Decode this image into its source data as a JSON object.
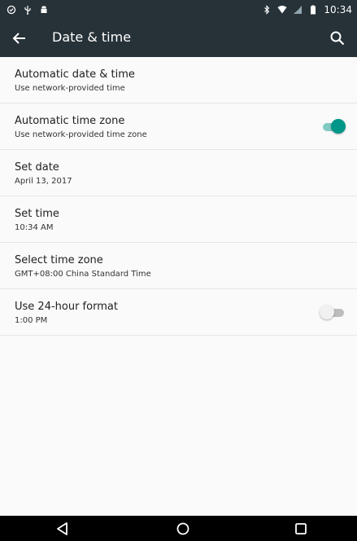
{
  "status_bar": {
    "time": "10:34",
    "icons_left": [
      "notification-icon",
      "usb-icon",
      "android-icon"
    ],
    "icons_right": [
      "bluetooth-icon",
      "wifi-icon",
      "signal-icon",
      "battery-icon"
    ]
  },
  "toolbar": {
    "title": "Date & time",
    "back_icon": "arrow-left-icon",
    "search_icon": "search-icon",
    "background": "#263238"
  },
  "settings": {
    "items": [
      {
        "title": "Automatic date & time",
        "summary": "Use network-provided time"
      },
      {
        "title": "Automatic time zone",
        "summary": "Use network-provided time zone",
        "toggle": "on"
      },
      {
        "title": "Set date",
        "summary": "April 13, 2017"
      },
      {
        "title": "Set time",
        "summary": "10:34 AM"
      },
      {
        "title": "Select time zone",
        "summary": "GMT+08:00 China Standard Time"
      },
      {
        "title": "Use 24-hour format",
        "summary": "1:00 PM",
        "toggle": "off"
      }
    ]
  },
  "colors": {
    "accent": "#009688",
    "accent_track": "#80cbc4"
  },
  "nav_bar": {
    "icons": [
      "back-triangle-icon",
      "home-circle-icon",
      "recents-square-icon"
    ]
  }
}
